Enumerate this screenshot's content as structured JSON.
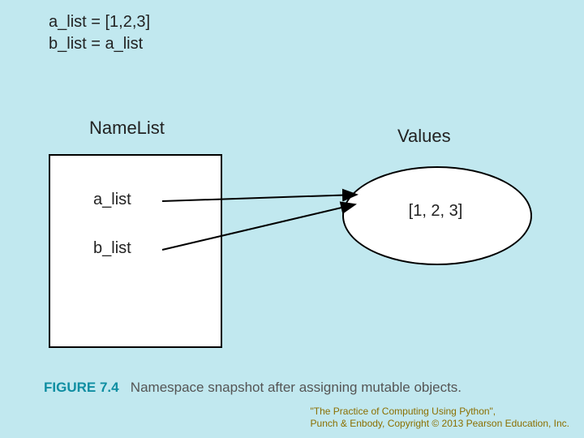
{
  "code": {
    "line1": "a_list = [1,2,3]",
    "line2": "b_list = a_list"
  },
  "labels": {
    "namelist": "NameList",
    "values": "Values"
  },
  "names": {
    "a": "a_list",
    "b": "b_list"
  },
  "value": "[1, 2, 3]",
  "caption": {
    "figure": "FIGURE 7.4",
    "text": "Namespace snapshot after assigning mutable objects."
  },
  "credit": {
    "line1": "\"The Practice of Computing Using Python\",",
    "line2": "Punch & Enbody, Copyright © 2013 Pearson Education, Inc."
  }
}
